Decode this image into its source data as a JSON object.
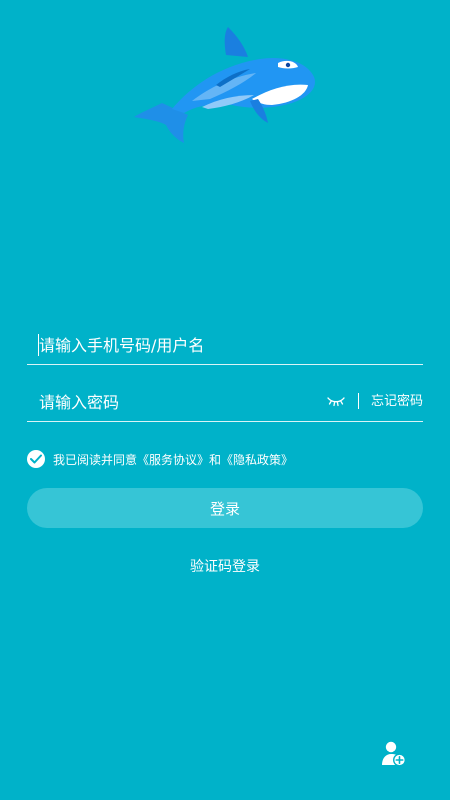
{
  "login": {
    "username_placeholder": "请输入手机号码/用户名",
    "password_placeholder": "请输入密码",
    "forgot_password": "忘记密码",
    "agreement": {
      "prefix": "我已阅读并同意",
      "terms": "《服务协议》",
      "and": "和",
      "privacy": "《隐私政策》",
      "checked": true
    },
    "login_button": "登录",
    "sms_login": "验证码登录"
  },
  "icons": {
    "logo": "orca-whale-logo",
    "password_visibility": "eye-closed-icon",
    "register": "add-user-icon",
    "agreement_check": "check-circle-icon"
  },
  "colors": {
    "background": "#00b2c9",
    "button": "#36c5d6",
    "text": "#ffffff"
  }
}
